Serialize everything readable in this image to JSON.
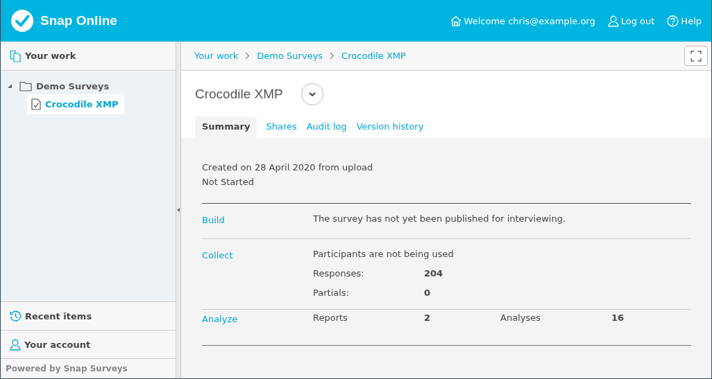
{
  "header": {
    "app_name": "Snap Online",
    "links": [
      {
        "kind": "home",
        "text": "Welcome chris@example.org"
      },
      {
        "kind": "user",
        "text": "Log out"
      },
      {
        "kind": "help",
        "text": "Help"
      }
    ]
  },
  "sidebar": {
    "title": "Your work",
    "tree": [
      {
        "label": "Demo Surveys",
        "expanded": true,
        "selected": false,
        "children": [
          {
            "label": "Crocodile XMP",
            "selected": true
          }
        ]
      }
    ],
    "footer_items": [
      {
        "kind": "recent",
        "label": "Recent items"
      },
      {
        "kind": "account",
        "label": "Your account"
      }
    ],
    "powered_by": "Powered by Snap Surveys"
  },
  "breadcrumb": [
    "Your work",
    "Demo Surveys",
    "Crocodile XMP"
  ],
  "title": "Crocodile XMP",
  "tabs": [
    {
      "label": "Summary",
      "selected": true
    },
    {
      "label": "Shares",
      "selected": false
    },
    {
      "label": "Audit log",
      "selected": false
    },
    {
      "label": "Version history",
      "selected": false
    }
  ],
  "summary": {
    "created": "Created on 28 April 2020 from upload",
    "status": "Not Started",
    "sections": [
      {
        "link": "Build",
        "lines": [
          [
            {
              "kind": "text",
              "text": "The survey has not yet been published for interviewing."
            }
          ]
        ]
      },
      {
        "link": "Collect",
        "lines": [
          [
            {
              "kind": "text",
              "text": "Participants are not being used"
            }
          ],
          [
            {
              "kind": "label",
              "text": "Responses:"
            },
            {
              "kind": "value",
              "text": "204"
            }
          ],
          [
            {
              "kind": "label",
              "text": "Partials:"
            },
            {
              "kind": "value",
              "text": "0"
            }
          ]
        ]
      },
      {
        "link": "Analyze",
        "lines": [
          [
            {
              "kind": "label",
              "text": "Reports"
            },
            {
              "kind": "value",
              "text": "2"
            },
            {
              "kind": "label",
              "text": "Analyses"
            },
            {
              "kind": "value",
              "text": "16"
            }
          ]
        ]
      }
    ]
  }
}
